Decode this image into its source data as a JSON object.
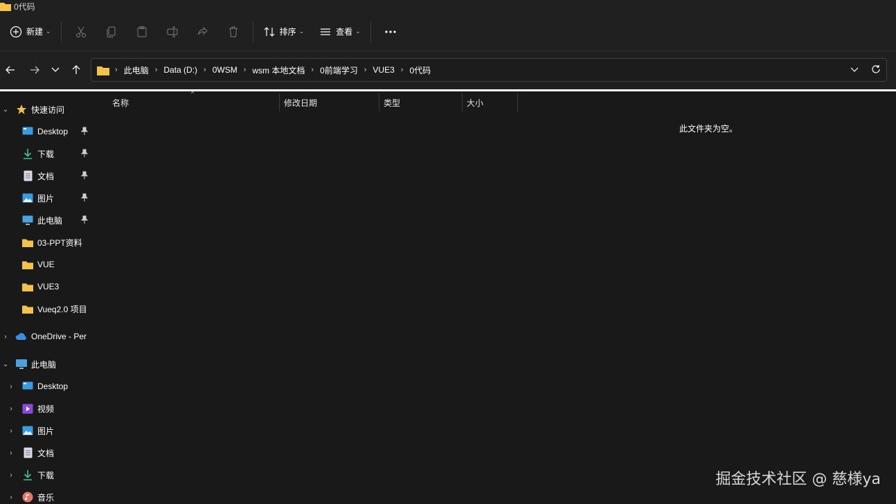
{
  "window": {
    "title": "0代码"
  },
  "toolbar": {
    "new_label": "新建",
    "sort_label": "排序",
    "view_label": "查看",
    "icons": [
      "cut-icon",
      "copy-icon",
      "paste-icon",
      "rename-icon",
      "share-icon",
      "delete-icon"
    ]
  },
  "breadcrumb": [
    "此电脑",
    "Data (D:)",
    "0WSM",
    "wsm 本地文档",
    "0前端学习",
    "VUE3",
    "0代码"
  ],
  "columns": [
    "名称",
    "修改日期",
    "类型",
    "大小"
  ],
  "empty_message": "此文件夹为空。",
  "sidebar": {
    "quick_access": "快速访问",
    "quick_items": [
      {
        "label": "Desktop",
        "icon": "desktop-icon",
        "pinned": true
      },
      {
        "label": "下载",
        "icon": "download-icon",
        "pinned": true
      },
      {
        "label": "文档",
        "icon": "document-icon",
        "pinned": true
      },
      {
        "label": "图片",
        "icon": "picture-icon",
        "pinned": true
      },
      {
        "label": "此电脑",
        "icon": "computer-icon",
        "pinned": true
      },
      {
        "label": "03-PPT资料",
        "icon": "folder-icon",
        "pinned": false
      },
      {
        "label": "VUE",
        "icon": "folder-icon",
        "pinned": false
      },
      {
        "label": "VUE3",
        "icon": "folder-icon",
        "pinned": false
      },
      {
        "label": "Vueq2.0 项目",
        "icon": "folder-icon",
        "pinned": false
      }
    ],
    "onedrive": "OneDrive - Per",
    "this_pc": "此电脑",
    "pc_items": [
      {
        "label": "Desktop",
        "icon": "desktop-icon"
      },
      {
        "label": "视频",
        "icon": "video-icon"
      },
      {
        "label": "图片",
        "icon": "picture-icon"
      },
      {
        "label": "文档",
        "icon": "document-icon"
      },
      {
        "label": "下载",
        "icon": "download-icon"
      },
      {
        "label": "音乐",
        "icon": "music-icon"
      }
    ]
  },
  "watermark": "掘金技术社区 @ 慈様ya",
  "colors": {
    "accent_folder": "#f2c14e",
    "background": "#191919",
    "chrome": "#202020"
  }
}
